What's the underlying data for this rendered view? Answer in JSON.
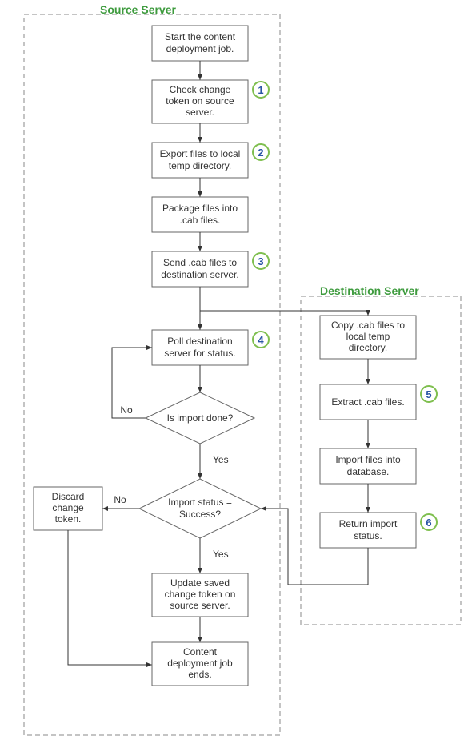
{
  "groups": {
    "source": {
      "title": "Source Server"
    },
    "dest": {
      "title": "Destination Server"
    }
  },
  "nodes": {
    "start": {
      "text": [
        "Start the content",
        "deployment job."
      ]
    },
    "check": {
      "text": [
        "Check change",
        "token on source",
        "server."
      ]
    },
    "export": {
      "text": [
        "Export files to local",
        "temp directory."
      ]
    },
    "package": {
      "text": [
        "Package files into",
        ".cab files."
      ]
    },
    "send": {
      "text": [
        "Send .cab files to",
        "destination server."
      ]
    },
    "poll": {
      "text": [
        "Poll destination",
        "server for status."
      ]
    },
    "isdone": {
      "text": [
        "Is import done?"
      ]
    },
    "success": {
      "text": [
        "Import status =",
        "Success?"
      ]
    },
    "discard": {
      "text": [
        "Discard",
        "change",
        "token."
      ]
    },
    "update": {
      "text": [
        "Update saved",
        "change token on",
        "source server."
      ]
    },
    "end": {
      "text": [
        "Content",
        "deployment job",
        "ends."
      ]
    },
    "copy": {
      "text": [
        "Copy .cab files to",
        "local temp",
        "directory."
      ]
    },
    "extract": {
      "text": [
        "Extract .cab files."
      ]
    },
    "import": {
      "text": [
        "Import files into",
        "database."
      ]
    },
    "return": {
      "text": [
        "Return import",
        "status."
      ]
    }
  },
  "edgeLabels": {
    "isdone_no": "No",
    "isdone_yes": "Yes",
    "success_no": "No",
    "success_yes": "Yes"
  },
  "annotations": {
    "a1": "1",
    "a2": "2",
    "a3": "3",
    "a4": "4",
    "a5": "5",
    "a6": "6"
  },
  "chart_data": {
    "type": "flowchart",
    "groups": [
      {
        "id": "source",
        "label": "Source Server",
        "nodes": [
          "start",
          "check",
          "export",
          "package",
          "send",
          "poll",
          "isdone",
          "success",
          "discard",
          "update",
          "end"
        ]
      },
      {
        "id": "dest",
        "label": "Destination Server",
        "nodes": [
          "copy",
          "extract",
          "import",
          "return"
        ]
      }
    ],
    "nodes": [
      {
        "id": "start",
        "shape": "rect",
        "label": "Start the content deployment job."
      },
      {
        "id": "check",
        "shape": "rect",
        "label": "Check change token on source server.",
        "annotation": 1
      },
      {
        "id": "export",
        "shape": "rect",
        "label": "Export files to local temp directory.",
        "annotation": 2
      },
      {
        "id": "package",
        "shape": "rect",
        "label": "Package files into .cab files."
      },
      {
        "id": "send",
        "shape": "rect",
        "label": "Send .cab files to destination server.",
        "annotation": 3
      },
      {
        "id": "poll",
        "shape": "rect",
        "label": "Poll destination server for status.",
        "annotation": 4
      },
      {
        "id": "isdone",
        "shape": "diamond",
        "label": "Is import done?"
      },
      {
        "id": "success",
        "shape": "diamond",
        "label": "Import status = Success?"
      },
      {
        "id": "discard",
        "shape": "rect",
        "label": "Discard change token."
      },
      {
        "id": "update",
        "shape": "rect",
        "label": "Update saved change token on source server."
      },
      {
        "id": "end",
        "shape": "rect",
        "label": "Content deployment job ends."
      },
      {
        "id": "copy",
        "shape": "rect",
        "label": "Copy .cab files to local temp directory."
      },
      {
        "id": "extract",
        "shape": "rect",
        "label": "Extract .cab files.",
        "annotation": 5
      },
      {
        "id": "import",
        "shape": "rect",
        "label": "Import files into database."
      },
      {
        "id": "return",
        "shape": "rect",
        "label": "Return import status.",
        "annotation": 6
      }
    ],
    "edges": [
      {
        "from": "start",
        "to": "check"
      },
      {
        "from": "check",
        "to": "export"
      },
      {
        "from": "export",
        "to": "package"
      },
      {
        "from": "package",
        "to": "send"
      },
      {
        "from": "send",
        "to": "poll"
      },
      {
        "from": "send",
        "to": "copy"
      },
      {
        "from": "poll",
        "to": "isdone"
      },
      {
        "from": "isdone",
        "to": "poll",
        "label": "No"
      },
      {
        "from": "isdone",
        "to": "success",
        "label": "Yes"
      },
      {
        "from": "success",
        "to": "discard",
        "label": "No"
      },
      {
        "from": "success",
        "to": "update",
        "label": "Yes"
      },
      {
        "from": "update",
        "to": "end"
      },
      {
        "from": "discard",
        "to": "end"
      },
      {
        "from": "copy",
        "to": "extract"
      },
      {
        "from": "extract",
        "to": "import"
      },
      {
        "from": "import",
        "to": "return"
      },
      {
        "from": "return",
        "to": "success"
      }
    ]
  }
}
